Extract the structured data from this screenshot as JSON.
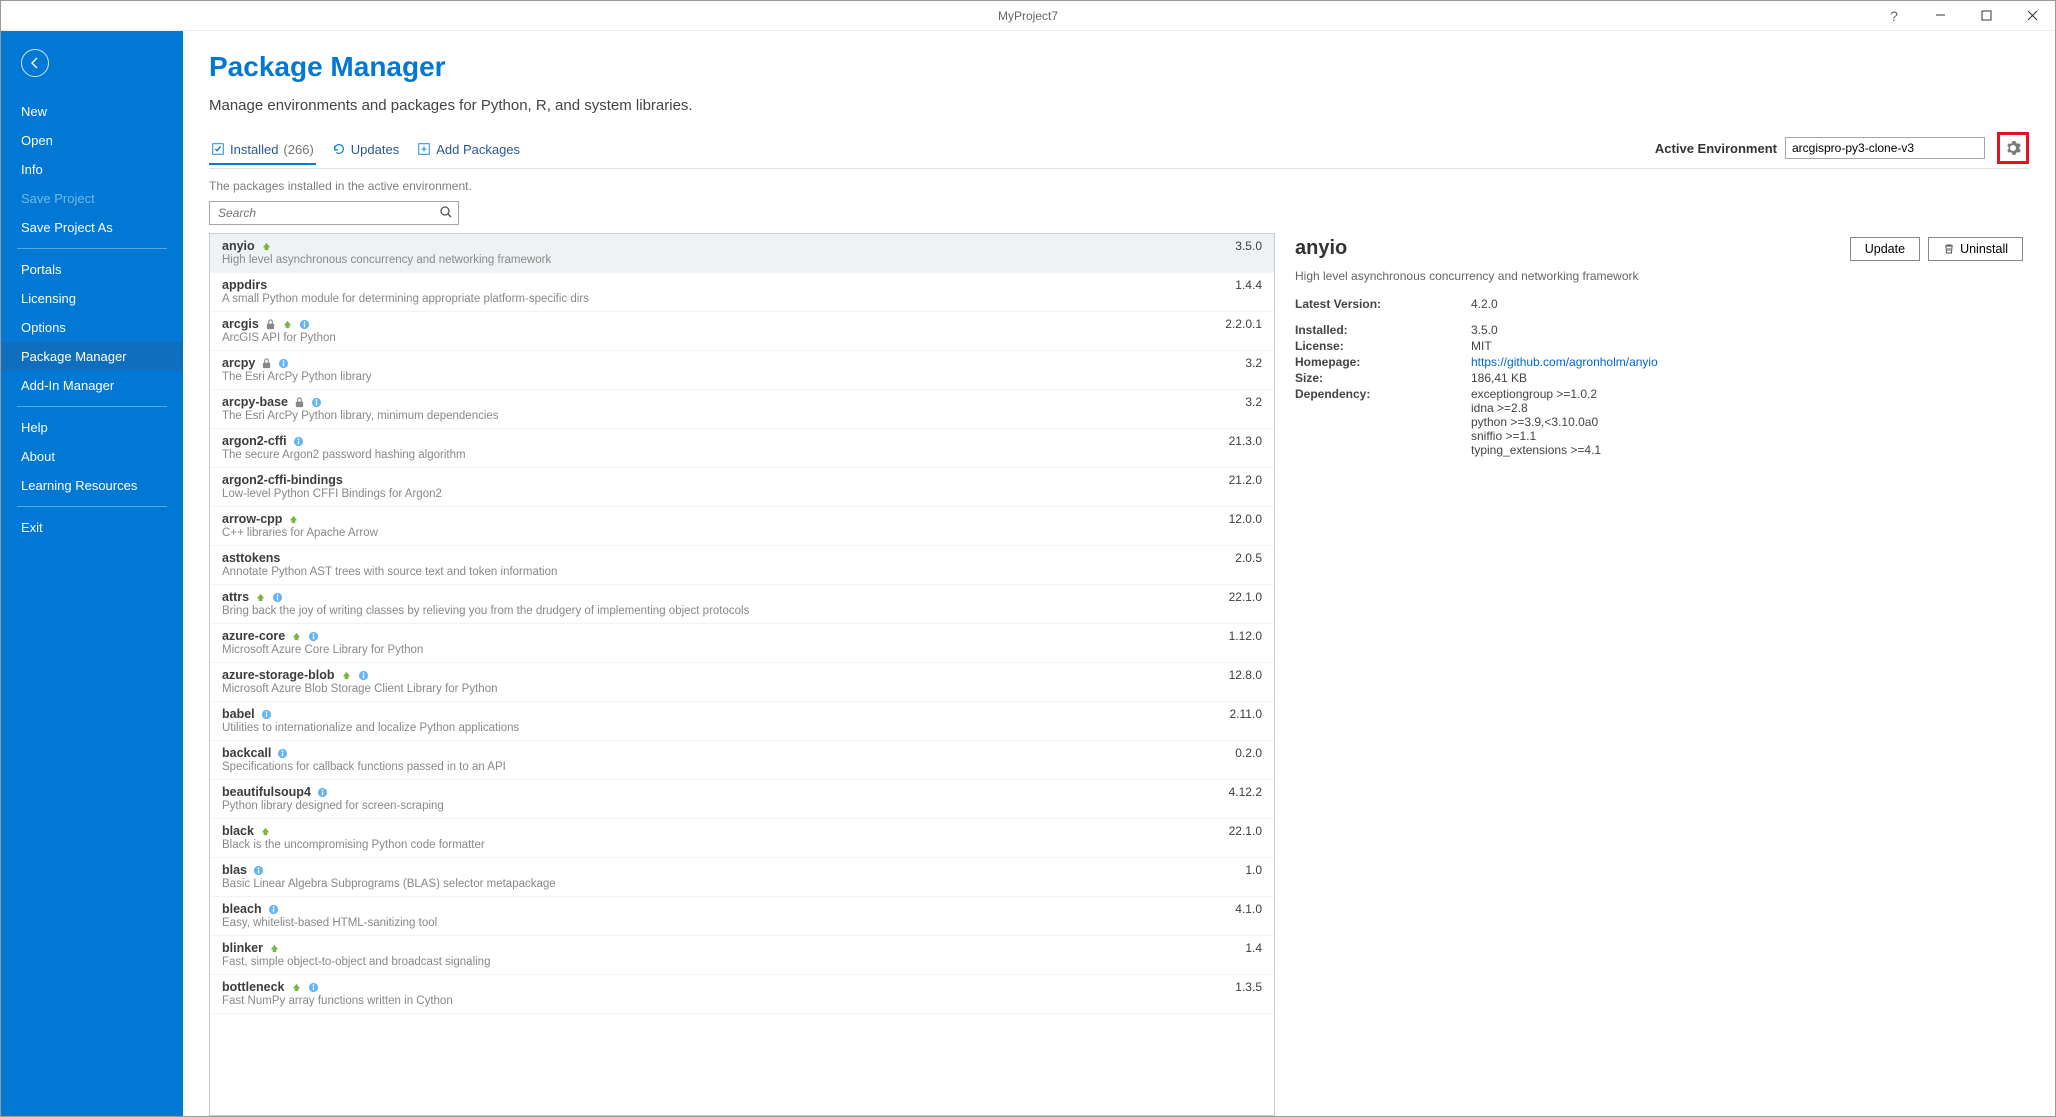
{
  "titlebar": {
    "title": "MyProject7"
  },
  "sidebar": {
    "items": [
      {
        "label": "New",
        "name": "side-new"
      },
      {
        "label": "Open",
        "name": "side-open"
      },
      {
        "label": "Info",
        "name": "side-info"
      },
      {
        "label": "Save Project",
        "name": "side-save",
        "disabled": true
      },
      {
        "label": "Save Project As",
        "name": "side-save-as"
      },
      {
        "divider": true
      },
      {
        "label": "Portals",
        "name": "side-portals"
      },
      {
        "label": "Licensing",
        "name": "side-licensing"
      },
      {
        "label": "Options",
        "name": "side-options"
      },
      {
        "label": "Package Manager",
        "name": "side-package-manager",
        "active": true
      },
      {
        "label": "Add-In Manager",
        "name": "side-addin-manager"
      },
      {
        "divider": true
      },
      {
        "label": "Help",
        "name": "side-help"
      },
      {
        "label": "About",
        "name": "side-about"
      },
      {
        "label": "Learning Resources",
        "name": "side-learning"
      },
      {
        "divider": true
      },
      {
        "label": "Exit",
        "name": "side-exit"
      }
    ]
  },
  "page": {
    "title": "Package Manager",
    "subtitle": "Manage environments and packages for Python, R, and system libraries.",
    "hint": "The packages installed in the active environment."
  },
  "tabs": {
    "installed": {
      "label": "Installed",
      "count": "(266)"
    },
    "updates": {
      "label": "Updates"
    },
    "add": {
      "label": "Add Packages"
    }
  },
  "env": {
    "label": "Active Environment",
    "value": "arcgispro-py3-clone-v3"
  },
  "search": {
    "placeholder": "Search"
  },
  "packages": [
    {
      "name": "anyio",
      "desc": "High level asynchronous concurrency and networking framework",
      "ver": "3.5.0",
      "up": true,
      "selected": true
    },
    {
      "name": "appdirs",
      "desc": "A small Python module for determining appropriate platform-specific dirs",
      "ver": "1.4.4"
    },
    {
      "name": "arcgis",
      "desc": "ArcGIS API for Python",
      "ver": "2.2.0.1",
      "lock": true,
      "up": true,
      "info": true
    },
    {
      "name": "arcpy",
      "desc": "The Esri ArcPy Python library",
      "ver": "3.2",
      "lock": true,
      "info": true
    },
    {
      "name": "arcpy-base",
      "desc": "The Esri ArcPy Python library, minimum dependencies",
      "ver": "3.2",
      "lock": true,
      "info": true
    },
    {
      "name": "argon2-cffi",
      "desc": "The secure Argon2 password hashing algorithm",
      "ver": "21.3.0",
      "info": true
    },
    {
      "name": "argon2-cffi-bindings",
      "desc": "Low-level Python CFFI Bindings for Argon2",
      "ver": "21.2.0"
    },
    {
      "name": "arrow-cpp",
      "desc": "C++ libraries for Apache Arrow",
      "ver": "12.0.0",
      "up": true
    },
    {
      "name": "asttokens",
      "desc": "Annotate Python AST trees with source text and token information",
      "ver": "2.0.5"
    },
    {
      "name": "attrs",
      "desc": "Bring back the joy of writing classes by relieving you from the drudgery of implementing object protocols",
      "ver": "22.1.0",
      "up": true,
      "info": true
    },
    {
      "name": "azure-core",
      "desc": "Microsoft Azure Core Library for Python",
      "ver": "1.12.0",
      "up": true,
      "info": true
    },
    {
      "name": "azure-storage-blob",
      "desc": "Microsoft Azure Blob Storage Client Library for Python",
      "ver": "12.8.0",
      "up": true,
      "info": true
    },
    {
      "name": "babel",
      "desc": "Utilities to internationalize and localize Python applications",
      "ver": "2.11.0",
      "info": true
    },
    {
      "name": "backcall",
      "desc": "Specifications for callback functions passed in to an API",
      "ver": "0.2.0",
      "info": true
    },
    {
      "name": "beautifulsoup4",
      "desc": "Python library designed for screen-scraping",
      "ver": "4.12.2",
      "info": true
    },
    {
      "name": "black",
      "desc": "Black is the uncompromising Python code formatter",
      "ver": "22.1.0",
      "up": true
    },
    {
      "name": "blas",
      "desc": "Basic Linear Algebra Subprograms (BLAS) selector metapackage",
      "ver": "1.0",
      "info": true
    },
    {
      "name": "bleach",
      "desc": "Easy, whitelist-based HTML-sanitizing tool",
      "ver": "4.1.0",
      "info": true
    },
    {
      "name": "blinker",
      "desc": "Fast, simple object-to-object and broadcast signaling",
      "ver": "1.4",
      "up": true
    },
    {
      "name": "bottleneck",
      "desc": "Fast NumPy array functions written in Cython",
      "ver": "1.3.5",
      "up": true,
      "info": true
    }
  ],
  "detail": {
    "title": "anyio",
    "update_label": "Update",
    "uninstall_label": "Uninstall",
    "subtitle": "High level asynchronous concurrency and networking framework",
    "rows": {
      "latest_label": "Latest Version:",
      "latest_val": "4.2.0",
      "installed_label": "Installed:",
      "installed_val": "3.5.0",
      "license_label": "License:",
      "license_val": "MIT",
      "home_label": "Homepage:",
      "home_val": "https://github.com/agronholm/anyio",
      "size_label": "Size:",
      "size_val": "186,41 KB",
      "dep_label": "Dependency:",
      "deps": [
        "exceptiongroup >=1.0.2",
        "idna >=2.8",
        "python >=3.9,<3.10.0a0",
        "sniffio >=1.1",
        "typing_extensions >=4.1"
      ]
    }
  }
}
